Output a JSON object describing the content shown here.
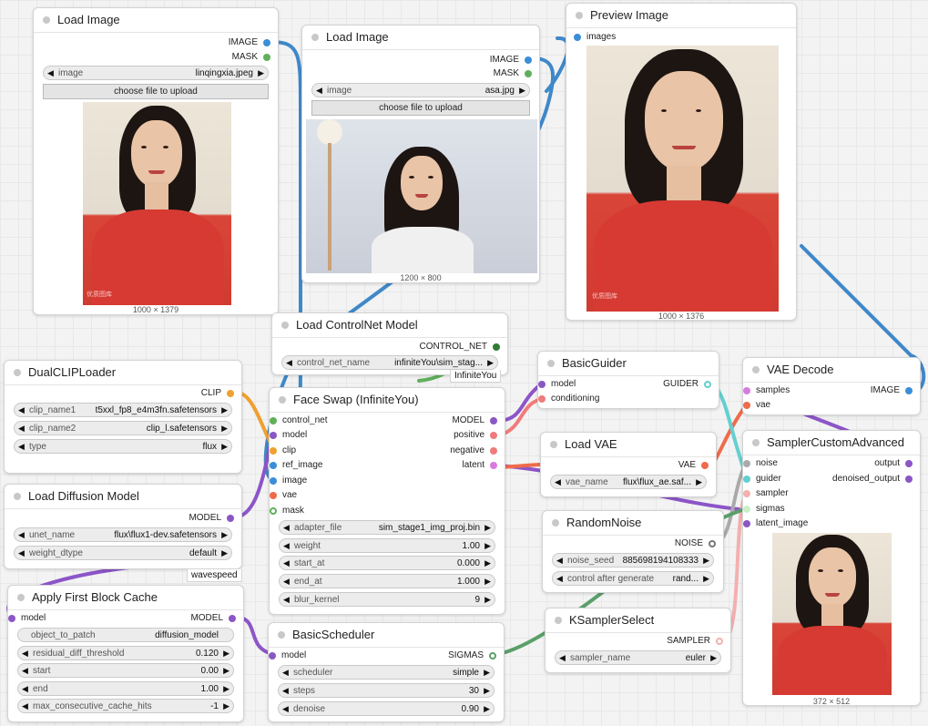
{
  "colors": {
    "image": "#3b8ed8",
    "mask": "#5fb05a",
    "model": "#8a57c4",
    "clip": "#f0a030",
    "vae": "#ef6b4b",
    "conditioning": "#f07b7b",
    "latent": "#d67ce0",
    "noise": "#aaaaaa",
    "guider": "#63d0d0",
    "sampler": "#f4b0b0",
    "sigmas": "#c8f0c8",
    "control_net": "#2e7d32",
    "wire_blue": "#3f88c9",
    "wire_purple": "#8c55c8"
  },
  "load_image_1": {
    "title": "Load Image",
    "out_image": "IMAGE",
    "out_mask": "MASK",
    "image_label": "image",
    "image_value": "linqingxia.jpeg",
    "upload": "choose file to upload",
    "size": "1000 × 1379",
    "watermark": "优质图库"
  },
  "load_image_2": {
    "title": "Load Image",
    "out_image": "IMAGE",
    "out_mask": "MASK",
    "image_label": "image",
    "image_value": "asa.jpg",
    "upload": "choose file to upload",
    "size": "1200 × 800"
  },
  "preview": {
    "title": "Preview Image",
    "in_images": "images",
    "size": "1000 × 1376",
    "watermark": "优质图库"
  },
  "controlnet": {
    "title": "Load ControlNet Model",
    "out": "CONTROL_NET",
    "w_label": "control_net_name",
    "w_value": "infiniteYou\\sim_stag...",
    "tag": "InfiniteYou"
  },
  "dualclip": {
    "title": "DualCLIPLoader",
    "out": "CLIP",
    "w1_label": "clip_name1",
    "w1_value": "t5xxl_fp8_e4m3fn.safetensors",
    "w2_label": "clip_name2",
    "w2_value": "clip_l.safetensors",
    "w3_label": "type",
    "w3_value": "flux"
  },
  "diffusion": {
    "title": "Load Diffusion Model",
    "out": "MODEL",
    "w1_label": "unet_name",
    "w1_value": "flux\\flux1-dev.safetensors",
    "w2_label": "weight_dtype",
    "w2_value": "default",
    "tag": "wavespeed"
  },
  "fbcache": {
    "title": "Apply First Block Cache",
    "in_model": "model",
    "out": "MODEL",
    "w0_label": "object_to_patch",
    "w0_value": "diffusion_model",
    "w1_label": "residual_diff_threshold",
    "w1_value": "0.120",
    "w2_label": "start",
    "w2_value": "0.00",
    "w3_label": "end",
    "w3_value": "1.00",
    "w4_label": "max_consecutive_cache_hits",
    "w4_value": "-1"
  },
  "faceswap": {
    "title": "Face Swap (InfiniteYou)",
    "in_control_net": "control_net",
    "in_model": "model",
    "in_clip": "clip",
    "in_ref_image": "ref_image",
    "in_image": "image",
    "in_vae": "vae",
    "in_mask": "mask",
    "out_model": "MODEL",
    "out_positive": "positive",
    "out_negative": "negative",
    "out_latent": "latent",
    "w1_label": "adapter_file",
    "w1_value": "sim_stage1_img_proj.bin",
    "w2_label": "weight",
    "w2_value": "1.00",
    "w3_label": "start_at",
    "w3_value": "0.000",
    "w4_label": "end_at",
    "w4_value": "1.000",
    "w5_label": "blur_kernel",
    "w5_value": "9"
  },
  "basicguider": {
    "title": "BasicGuider",
    "in_model": "model",
    "in_conditioning": "conditioning",
    "out": "GUIDER"
  },
  "loadvae": {
    "title": "Load VAE",
    "out": "VAE",
    "w_label": "vae_name",
    "w_value": "flux\\flux_ae.saf..."
  },
  "randomnoise": {
    "title": "RandomNoise",
    "out": "NOISE",
    "w1_label": "noise_seed",
    "w1_value": "885698194108333",
    "w2_label": "control after generate",
    "w2_value": "rand..."
  },
  "ksampler": {
    "title": "KSamplerSelect",
    "out": "SAMPLER",
    "w_label": "sampler_name",
    "w_value": "euler"
  },
  "scheduler": {
    "title": "BasicScheduler",
    "in_model": "model",
    "out": "SIGMAS",
    "w1_label": "scheduler",
    "w1_value": "simple",
    "w2_label": "steps",
    "w2_value": "30",
    "w3_label": "denoise",
    "w3_value": "0.90"
  },
  "vaedecode": {
    "title": "VAE Decode",
    "in_samples": "samples",
    "in_vae": "vae",
    "out": "IMAGE"
  },
  "sampler": {
    "title": "SamplerCustomAdvanced",
    "in_noise": "noise",
    "in_guider": "guider",
    "in_sampler": "sampler",
    "in_sigmas": "sigmas",
    "in_latent": "latent_image",
    "out_output": "output",
    "out_denoised": "denoised_output",
    "size": "372 × 512"
  }
}
